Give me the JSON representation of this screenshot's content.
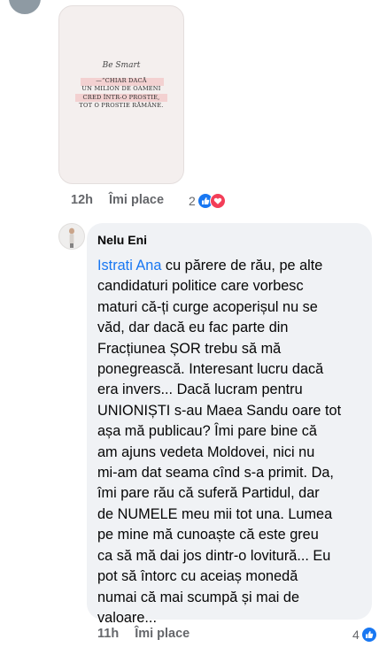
{
  "colors": {
    "accent": "#1877f2",
    "love": "#f33e58",
    "meta_text": "#65676b",
    "bubble_bg": "#f0f2f5"
  },
  "image_post": {
    "signature": "Be Smart",
    "quote_lines": [
      "—“CHIAR DACĂ",
      "UN MILION DE OAMENI",
      "CRED ÎNTR-O PROSTIE,",
      "TOT O PROSTIE RĂMÂNE."
    ]
  },
  "first_meta": {
    "time": "12h",
    "like_label": "Îmi place",
    "reactions_count": "2",
    "reaction_icons": [
      "like-icon",
      "love-icon"
    ]
  },
  "comment": {
    "author": "Nelu Eni",
    "mention": "Istrati Ana",
    "text": " cu părere de rău, pe alte\ncandidaturi politice care vorbesc\nmaturi că-ți curge acoperișul nu se\nvăd, dar dacă eu fac parte din\nFracțiunea ȘOR trebu să mă\nponegrească. Interesant lucru dacă\nera invers... Dacă lucram pentru\nUNIONIȘTI s-au Maea Sandu oare tot\nașa mă publicau? Îmi pare bine că\nam ajuns vedeta Moldovei, nici nu\nmi-am dat seama cînd s-a primit. Da,\nîmi pare rău că suferă Partidul, dar\nde NUMELE meu mii tot una. Lumea\npe mine mă cunoaște că este greu\nca să mă dai jos dintr-o lovitură... Eu\npot să întorc cu aceiaș monedă\nnumai că mai scumpă și mai de\nvaloare..."
  },
  "second_meta": {
    "time": "11h",
    "like_label": "Îmi place",
    "reactions_count": "4",
    "reaction_icons": [
      "like-icon"
    ]
  }
}
